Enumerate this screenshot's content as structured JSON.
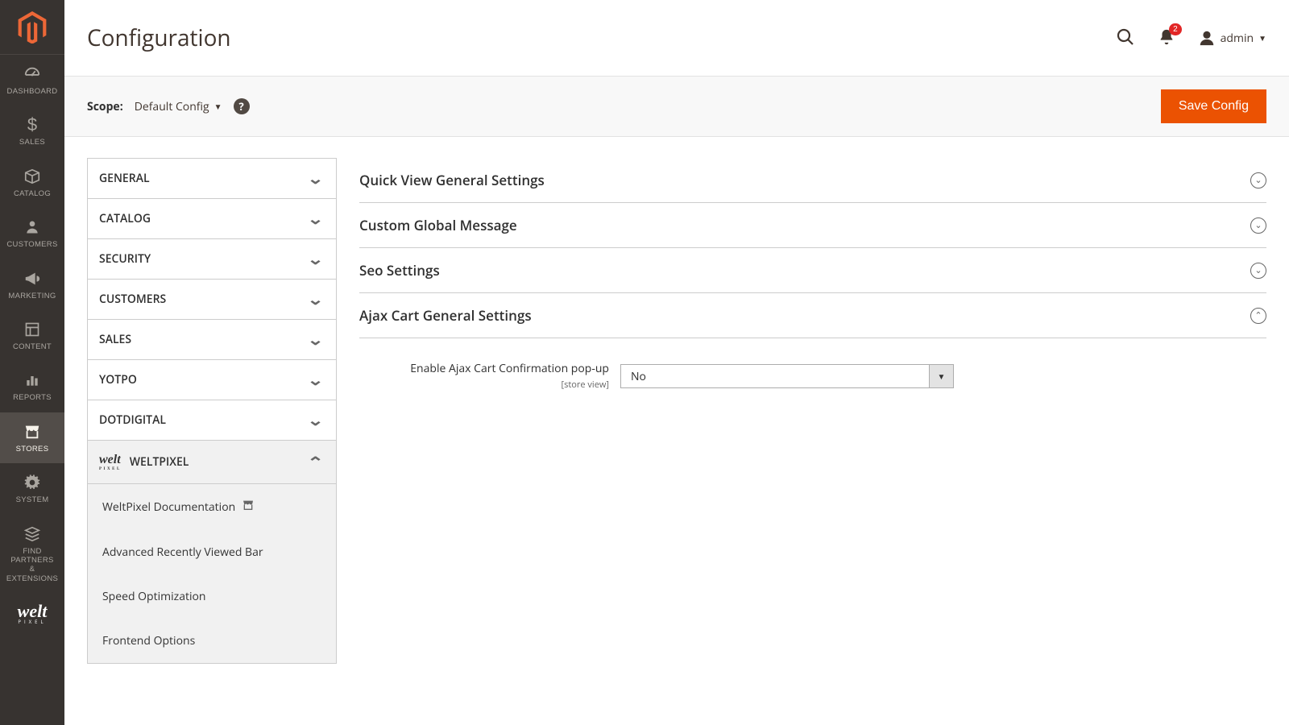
{
  "header": {
    "page_title": "Configuration",
    "notification_count": "2",
    "user_name": "admin"
  },
  "scope": {
    "label": "Scope:",
    "selected": "Default Config",
    "save_button": "Save Config"
  },
  "sidebar": {
    "items": [
      {
        "label": "DASHBOARD"
      },
      {
        "label": "SALES"
      },
      {
        "label": "CATALOG"
      },
      {
        "label": "CUSTOMERS"
      },
      {
        "label": "MARKETING"
      },
      {
        "label": "CONTENT"
      },
      {
        "label": "REPORTS"
      },
      {
        "label": "STORES"
      },
      {
        "label": "SYSTEM"
      },
      {
        "label": "FIND PARTNERS\n& EXTENSIONS"
      }
    ]
  },
  "tabs": [
    {
      "label": "GENERAL"
    },
    {
      "label": "CATALOG"
    },
    {
      "label": "SECURITY"
    },
    {
      "label": "CUSTOMERS"
    },
    {
      "label": "SALES"
    },
    {
      "label": "YOTPO"
    },
    {
      "label": "DOTDIGITAL"
    },
    {
      "label": "WELTPIXEL"
    }
  ],
  "subtabs": [
    {
      "label": "WeltPixel Documentation"
    },
    {
      "label": "Advanced Recently Viewed Bar"
    },
    {
      "label": "Speed Optimization"
    },
    {
      "label": "Frontend Options"
    }
  ],
  "sections": [
    {
      "title": "Quick View General Settings"
    },
    {
      "title": "Custom Global Message"
    },
    {
      "title": "Seo Settings"
    },
    {
      "title": "Ajax Cart General Settings"
    }
  ],
  "ajax_field": {
    "label": "Enable Ajax Cart Confirmation pop-up",
    "scope": "[store view]",
    "value": "No"
  },
  "colors": {
    "accent": "#eb5202",
    "sidebar_bg": "#373330"
  }
}
